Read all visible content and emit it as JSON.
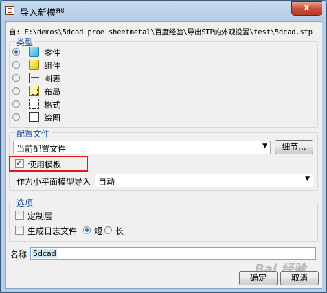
{
  "window": {
    "title": "导入新模型",
    "close_label": "x"
  },
  "path_text": "自: E:\\demos\\5dcad_proe_sheetmetal\\百度经验\\导出STP的外观设置\\test\\5dcad.stp",
  "type_group": {
    "title": "类型",
    "options": [
      {
        "label": "零件",
        "icon": "part-icon",
        "selected": true
      },
      {
        "label": "组件",
        "icon": "assembly-icon",
        "selected": false
      },
      {
        "label": "图表",
        "icon": "diagram-icon",
        "selected": false
      },
      {
        "label": "布局",
        "icon": "layout-icon",
        "selected": false
      },
      {
        "label": "格式",
        "icon": "format-icon",
        "selected": false
      },
      {
        "label": "绘图",
        "icon": "sketch-icon",
        "selected": false
      }
    ]
  },
  "profile_group": {
    "title": "配置文件",
    "profile_value": "当前配置文件",
    "details_button": "细节...",
    "use_template_label": "使用模板",
    "use_template_checked": true,
    "import_as_label": "作为小平面模型导入",
    "import_as_value": "自动"
  },
  "options_group": {
    "title": "选项",
    "custom_layer_label": "定制层",
    "log_file_label": "生成日志文件",
    "short_label": "短",
    "long_label": "长"
  },
  "name_field": {
    "label": "名称",
    "value": "5dcad"
  },
  "buttons": {
    "ok": "确定",
    "cancel": "取消"
  },
  "watermark": "Bai 经验"
}
